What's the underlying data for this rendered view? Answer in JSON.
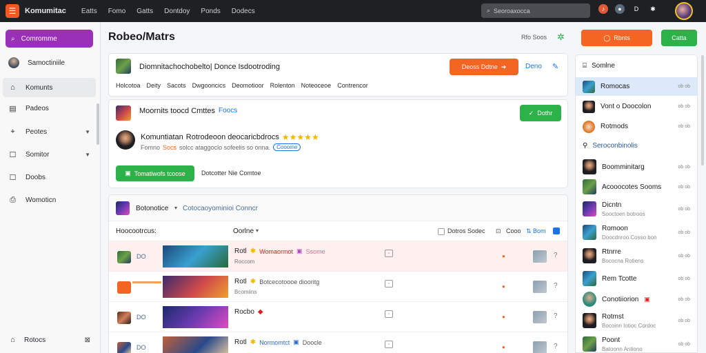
{
  "topbar": {
    "brand": "Komumitac",
    "nav": [
      "Eatts",
      "Fomo",
      "Gatts",
      "Dontdoy",
      "Ponds",
      "Dodecs"
    ],
    "search_placeholder": "Seoroaxocca"
  },
  "sidebar": {
    "primary_label": "Comromme",
    "profile_label": "Samoctiniile",
    "items": [
      {
        "label": "Komunts",
        "icon": "home-icon",
        "active": true,
        "chevron": false
      },
      {
        "label": "Padeos",
        "icon": "list-icon",
        "active": false,
        "chevron": false
      },
      {
        "label": "Peotes",
        "icon": "map-pin-icon",
        "active": false,
        "chevron": true
      },
      {
        "label": "Somitor",
        "icon": "square-icon",
        "active": false,
        "chevron": true
      },
      {
        "label": "Doobs",
        "icon": "square-icon",
        "active": false,
        "chevron": false
      },
      {
        "label": "Womoticn",
        "icon": "document-icon",
        "active": false,
        "chevron": false
      }
    ],
    "bottom_label": "Rotocs"
  },
  "header": {
    "title": "Robeo/Matrs",
    "link": "Rfo Soos",
    "orange_button": "Rbnts",
    "green_button": "Catta"
  },
  "summary_card": {
    "title": "Diomnitachochobelto| Donce Isdootroding",
    "action_button": "Deoss Ddtne",
    "link": "Deno",
    "tabs": [
      "Holcotoa",
      "Deity",
      "Sacots",
      "Dwgooncics",
      "Deomotioor",
      "Rolenton",
      "Noteoceoe",
      "Contrencor"
    ]
  },
  "project_card": {
    "title": "Moornits toocd Cmttes",
    "subtitle": "Foocs",
    "follow_button": "Dothr",
    "author": "Komuntiatan",
    "author_desc": "Rotrodeoon deocaricbdrocs",
    "rating_stars": "★★★★★",
    "meta_1": "Fomno",
    "meta_2": "Socs",
    "meta_rest": "solcc ataggoclo sofeelis so onna.",
    "badge": "Cooome",
    "primary_action": "Tomatiwofs tcoose",
    "secondary_action": "Dotcotter Nie Comtoe"
  },
  "table": {
    "tab_label": "Botonotice",
    "tab_extra": "Cotocaoyominioi Conncr",
    "header_left": "Hoocootrcus:",
    "header_mid": "Oorlne",
    "header_check": "Dotros Sodec",
    "header_btn": "Cooo",
    "header_sort": "Bom",
    "rows": [
      {
        "code": "DO",
        "title": "Rotl",
        "tag_a": "Womaormot",
        "tag_b": "Ssome",
        "sub": "Roccom",
        "highlight": true
      },
      {
        "code": "",
        "title": "Rotl",
        "tag_a": "Botcecotoooe diooritg",
        "tag_b": "",
        "sub": "Bcomiins",
        "highlight": false
      },
      {
        "code": "DO",
        "title": "Rocbo",
        "tag_a": "",
        "tag_b": "",
        "sub": "",
        "highlight": false
      },
      {
        "code": "DO",
        "title": "Rotl",
        "tag_a": "Normomtct",
        "tag_b": "Doocle",
        "sub": "",
        "highlight": false
      }
    ]
  },
  "right_panel": {
    "header": "Somlne",
    "top_items": [
      {
        "name": "Romocas",
        "time": "ob ob",
        "selected": true
      },
      {
        "name": "Vont o Doocolon",
        "time": "ob ob",
        "selected": false
      },
      {
        "name": "Rotmods",
        "time": "ob ob",
        "selected": false
      }
    ],
    "section": "Seroconbinolis",
    "people": [
      {
        "name": "Boomminitarg",
        "sub": "",
        "time": "ob ob"
      },
      {
        "name": "Acooocotes Sooms",
        "sub": "",
        "time": "ob ob"
      },
      {
        "name": "Dicntn",
        "sub": "Sooctoen botroos",
        "time": "ob ob"
      },
      {
        "name": "Romoon",
        "sub": "Doocdnroo Cosso bon",
        "time": "ob ob"
      },
      {
        "name": "Rtnrre",
        "sub": "Bococna Rotiens",
        "time": "ob ob"
      },
      {
        "name": "Rem Tcotte",
        "sub": "",
        "time": "ob ob"
      },
      {
        "name": "Conotiiorion",
        "sub": "",
        "time": "ob ob"
      },
      {
        "name": "Rotmst",
        "sub": "Bocoinn Iotioc Cordoc",
        "time": "ob ob"
      },
      {
        "name": "Poont",
        "sub": "Batoonn Antiono",
        "time": "ob ob"
      }
    ]
  },
  "colors": {
    "accent_orange": "#f26522",
    "accent_green": "#2db24a",
    "accent_purple": "#9a2fb8",
    "link_blue": "#1a73e8",
    "topbar": "#1e2024"
  }
}
